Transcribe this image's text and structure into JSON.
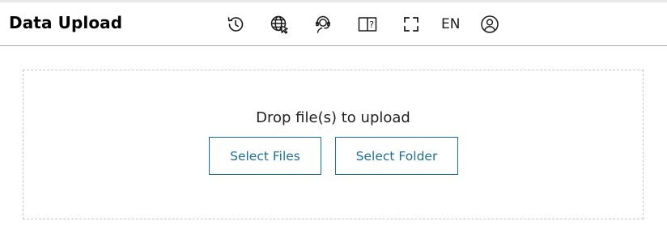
{
  "header": {
    "title": "Data Upload",
    "language": "EN",
    "icons": [
      "history-icon",
      "globe-cursor-icon",
      "support-agent-icon",
      "help-book-icon",
      "fullscreen-icon",
      "user-account-icon"
    ]
  },
  "upload": {
    "drop_text": "Drop file(s) to upload",
    "select_files_label": "Select Files",
    "select_folder_label": "Select Folder"
  },
  "colors": {
    "accent": "#1d6f99",
    "border_dashed": "#c6c6c6",
    "header_divider": "#a9a9a9"
  }
}
